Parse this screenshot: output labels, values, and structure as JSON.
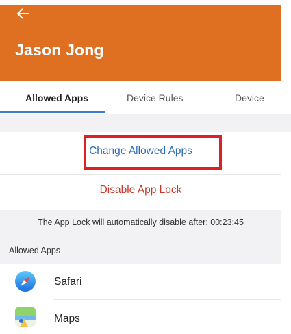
{
  "header": {
    "back_icon": "arrow-left-icon",
    "title": "Jason Jong",
    "background_color": "#e07021"
  },
  "tabs": [
    {
      "label": "Allowed Apps",
      "active": true
    },
    {
      "label": "Device Rules",
      "active": false
    },
    {
      "label": "Device",
      "active": false
    }
  ],
  "actions": {
    "change_allowed_apps": "Change Allowed Apps",
    "disable_app_lock": "Disable App Lock"
  },
  "info_text": "The App Lock will automatically disable after: 00:23:45",
  "section_label": "Allowed Apps",
  "apps": [
    {
      "name": "Safari",
      "icon": "safari-compass-icon"
    },
    {
      "name": "Maps",
      "icon": "maps-icon"
    }
  ],
  "colors": {
    "accent_tab": "#3d7cc9",
    "link_blue": "#2f6cb5",
    "danger_red": "#c0392b",
    "highlight_red": "#e02020"
  }
}
